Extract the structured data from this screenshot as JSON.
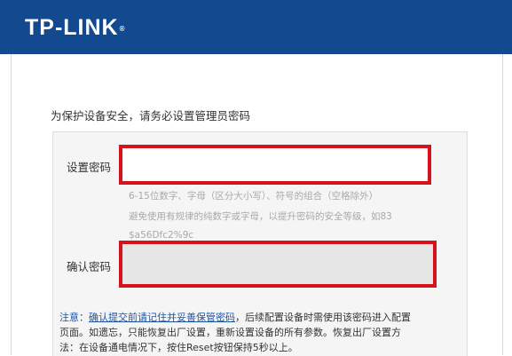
{
  "header": {
    "brand": "TP-LINK",
    "trademark": "®",
    "bg_color": "#12498f"
  },
  "form": {
    "prompt": "为保护设备安全，请务必设置管理员密码",
    "password_label": "设置密码",
    "password_value": "",
    "hint_line1": "6-15位数字、字母（区分大小写）、符号的组合（空格除外）",
    "hint_line2": "避免使用有规律的纯数字或字母，以提升密码的安全等级，如83",
    "hint_line3": "$a56Dfc2%9c",
    "confirm_label": "确认密码",
    "confirm_value": ""
  },
  "note": {
    "prefix": "注意：",
    "link": "确认提交前请记住并妥善保管密码",
    "line1_rest": "，后续配置设备时需使用该密码进入配置",
    "line2": "页面。如遗忘，只能恢复出厂设置，重新设置设备的所有参数。恢复出厂设置方",
    "line3": "法：在设备通电情况下，按住Reset按钮保持5秒以上。"
  },
  "colors": {
    "highlight": "#d6121c",
    "link": "#1f54a3"
  }
}
